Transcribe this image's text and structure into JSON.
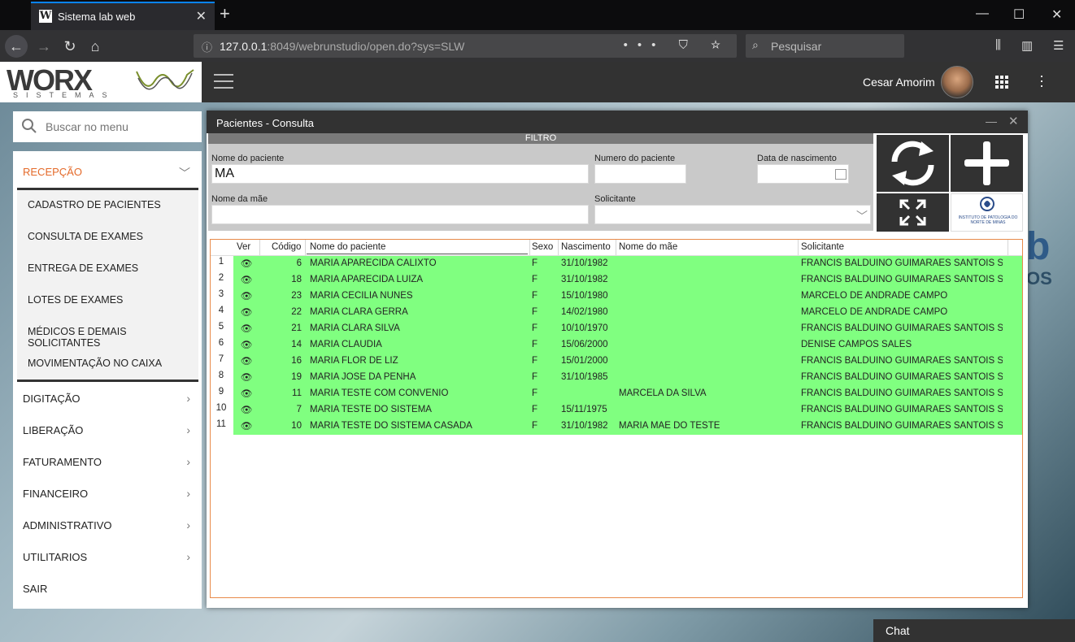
{
  "browser": {
    "tab_title": "Sistema lab web",
    "tab_favicon": "W",
    "url_host": "127.0.0.1",
    "url_rest": ":8049/webrunstudio/open.do?sys=SLW",
    "search_placeholder": "Pesquisar",
    "url_actions": "••• ⛉ ☆"
  },
  "header": {
    "logo_main": "WORX",
    "logo_sub": "SISTEMAS",
    "user_name": "Cesar Amorim"
  },
  "sidebar": {
    "search_placeholder": "Buscar no menu",
    "active_section": "RECEPÇÃO",
    "submenu": [
      "CADASTRO DE PACIENTES",
      "CONSULTA DE EXAMES",
      "ENTREGA DE EXAMES",
      "LOTES DE EXAMES",
      "MÉDICOS E DEMAIS SOLICITANTES",
      "MOVIMENTAÇÃO NO CAIXA"
    ],
    "sections": [
      "DIGITAÇÃO",
      "LIBERAÇÃO",
      "FATURAMENTO",
      "FINANCEIRO",
      "ADMINISTRATIVO",
      "UTILITARIOS"
    ],
    "exit": "SAIR"
  },
  "dialog": {
    "title": "Pacientes - Consulta",
    "filter_header": "FILTRO",
    "fields": {
      "nome_paciente_label": "Nome do paciente",
      "nome_paciente_value": "MA",
      "numero_label": "Numero do paciente",
      "numero_value": "",
      "nascimento_label": "Data de nascimento",
      "nascimento_value": "",
      "mae_label": "Nome da mãe",
      "mae_value": "",
      "solicitante_label": "Solicitante",
      "solicitante_value": ""
    },
    "logo_text": "INSTITUTO DE PATOLOGIA DO NORTE DE MINAS"
  },
  "table": {
    "columns": [
      "Ver",
      "Código",
      "Nome do paciente",
      "Sexo",
      "Nascimento",
      "Nome do mãe",
      "Solicitante"
    ],
    "rows": [
      {
        "n": "1",
        "codigo": "6",
        "nome": "MARIA APARECIDA CALIXTO",
        "sexo": "F",
        "nasc": "31/10/1982",
        "mae": "",
        "sol": "FRANCIS BALDUINO GUIMARÃES SANTOIS SILV..."
      },
      {
        "n": "2",
        "codigo": "18",
        "nome": "MARIA APARECIDA LUIZA",
        "sexo": "F",
        "nasc": "31/10/1982",
        "mae": "",
        "sol": "FRANCIS BALDUINO GUIMARÃES SANTOIS SILV..."
      },
      {
        "n": "3",
        "codigo": "23",
        "nome": "MARIA CECILIA NUNES",
        "sexo": "F",
        "nasc": "15/10/1980",
        "mae": "",
        "sol": "MARCELO DE ANDRADE CAMPO"
      },
      {
        "n": "4",
        "codigo": "22",
        "nome": "MARIA CLARA GERRA",
        "sexo": "F",
        "nasc": "14/02/1980",
        "mae": "",
        "sol": "MARCELO DE ANDRADE CAMPO"
      },
      {
        "n": "5",
        "codigo": "21",
        "nome": "MARIA CLARA SILVA",
        "sexo": "F",
        "nasc": "10/10/1970",
        "mae": "",
        "sol": "FRANCIS BALDUINO GUIMARÃES SANTOIS SILV..."
      },
      {
        "n": "6",
        "codigo": "14",
        "nome": "MARIA CLAUDIA",
        "sexo": "F",
        "nasc": "15/06/2000",
        "mae": "",
        "sol": "DENISE CAMPOS SALES"
      },
      {
        "n": "7",
        "codigo": "16",
        "nome": "MARIA FLOR DE LIZ",
        "sexo": "F",
        "nasc": "15/01/2000",
        "mae": "",
        "sol": "FRANCIS BALDUINO GUIMARÃES SANTOIS SILV..."
      },
      {
        "n": "8",
        "codigo": "19",
        "nome": "MARIA JOSE DA PENHA",
        "sexo": "F",
        "nasc": "31/10/1985",
        "mae": "",
        "sol": "FRANCIS BALDUINO GUIMARÃES SANTOIS SILV..."
      },
      {
        "n": "9",
        "codigo": "11",
        "nome": "MARIA TESTE COM CONVENIO",
        "sexo": "F",
        "nasc": "",
        "mae": "MARCELA DA SILVA",
        "sol": "FRANCIS BALDUINO GUIMARÃES SANTOIS SILV..."
      },
      {
        "n": "10",
        "codigo": "7",
        "nome": "MARIA TESTE DO SISTEMA",
        "sexo": "F",
        "nasc": "15/11/1975",
        "mae": "",
        "sol": "FRANCIS BALDUINO GUIMARÃES SANTOIS SILV..."
      },
      {
        "n": "11",
        "codigo": "10",
        "nome": "MARIA TESTE DO SISTEMA CASADA",
        "sexo": "F",
        "nasc": "31/10/1982",
        "mae": "MARIA MÃE DO TESTE",
        "sol": "FRANCIS BALDUINO GUIMARÃES SANTOIS SILV..."
      }
    ]
  },
  "chat_label": "Chat",
  "colors": {
    "accent": "#e46a2a",
    "row_highlight": "#80ff80",
    "dark": "#323232",
    "tab_accent": "#0a84ff"
  },
  "icons": {
    "refresh": "refresh-icon",
    "add": "plus-icon",
    "expand": "expand-icon",
    "view": "eye-icon",
    "calendar": "calendar-icon",
    "search": "search-icon"
  }
}
